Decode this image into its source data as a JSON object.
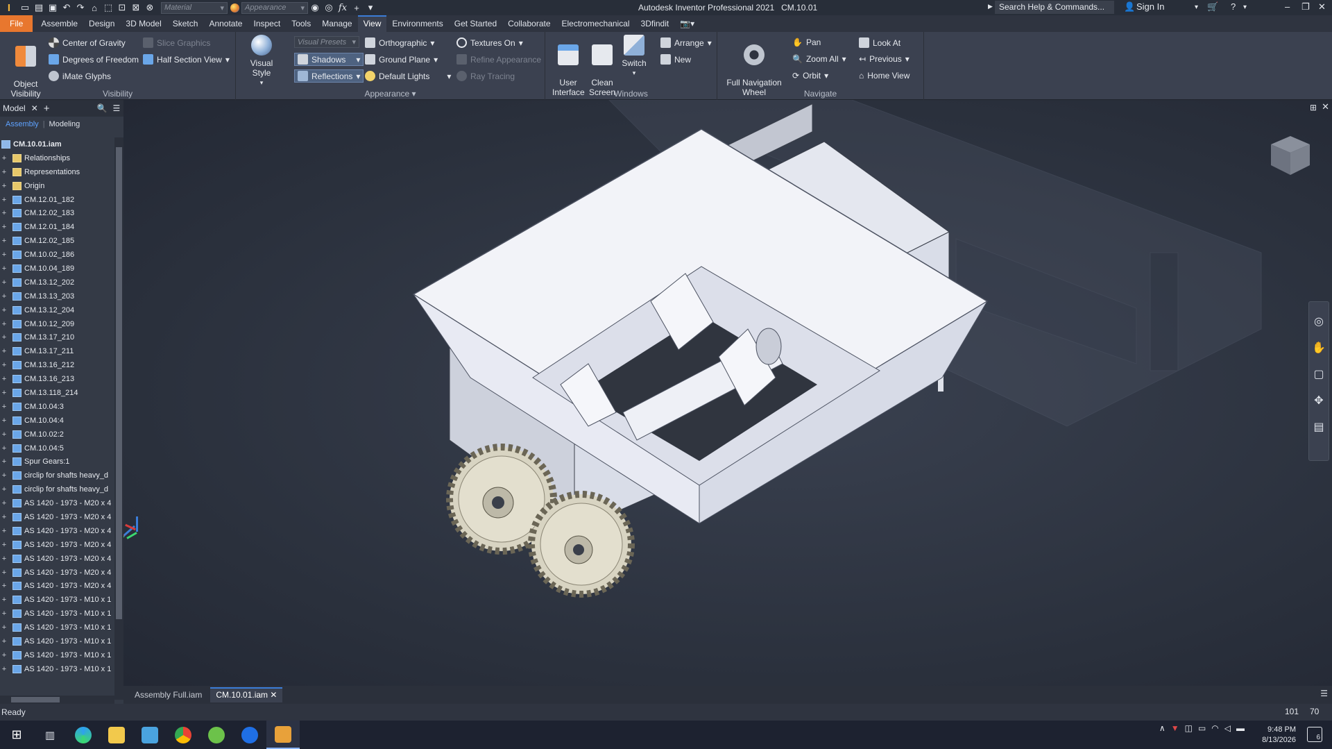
{
  "titlebar": {
    "material_placeholder": "Material",
    "appearance_placeholder": "Appearance",
    "title": "Autodesk Inventor Professional 2021",
    "document": "CM.10.01",
    "search": "Search Help & Commands...",
    "sign_in": "Sign In"
  },
  "tabs": [
    "File",
    "Assemble",
    "Design",
    "3D Model",
    "Sketch",
    "Annotate",
    "Inspect",
    "Tools",
    "Manage",
    "View",
    "Environments",
    "Get Started",
    "Collaborate",
    "Electromechanical",
    "3Dfindit"
  ],
  "active_tab": "View",
  "ribbon": {
    "visibility": {
      "title": "Visibility",
      "object_visibility": "Object\nVisibility",
      "center_of_gravity": "Center of Gravity",
      "degrees_of_freedom": "Degrees of Freedom",
      "imate_glyphs": "iMate Glyphs",
      "slice_graphics": "Slice Graphics",
      "half_section_view": "Half Section View"
    },
    "appearance": {
      "title": "Appearance",
      "visual_style": "Visual Style",
      "visual_presets": "Visual Presets",
      "shadows": "Shadows",
      "reflections": "Reflections",
      "orthographic": "Orthographic",
      "ground_plane": "Ground Plane",
      "default_lights": "Default Lights",
      "textures_on": "Textures On",
      "refine_appearance": "Refine Appearance",
      "ray_tracing": "Ray Tracing"
    },
    "windows": {
      "title": "Windows",
      "user_interface": "User\nInterface",
      "clean_screen": "Clean\nScreen",
      "switch": "Switch",
      "arrange": "Arrange",
      "new": "New"
    },
    "navigate": {
      "title": "Navigate",
      "full_navigation_wheel": "Full Navigation\nWheel",
      "pan": "Pan",
      "zoom_all": "Zoom All",
      "orbit": "Orbit",
      "look_at": "Look At",
      "previous": "Previous",
      "home_view": "Home View"
    }
  },
  "browser": {
    "tab": "Model",
    "sub_assembly": "Assembly",
    "sub_modeling": "Modeling",
    "root": "CM.10.01.iam",
    "items": [
      {
        "label": "Relationships",
        "kind": "folder"
      },
      {
        "label": "Representations",
        "kind": "folder"
      },
      {
        "label": "Origin",
        "kind": "folder"
      },
      {
        "label": "CM.12.01_182",
        "kind": "part"
      },
      {
        "label": "CM.12.02_183",
        "kind": "part"
      },
      {
        "label": "CM.12.01_184",
        "kind": "part"
      },
      {
        "label": "CM.12.02_185",
        "kind": "part"
      },
      {
        "label": "CM.10.02_186",
        "kind": "assembly"
      },
      {
        "label": "CM.10.04_189",
        "kind": "assembly"
      },
      {
        "label": "CM.13.12_202",
        "kind": "part"
      },
      {
        "label": "CM.13.13_203",
        "kind": "part"
      },
      {
        "label": "CM.13.12_204",
        "kind": "part"
      },
      {
        "label": "CM.10.12_209",
        "kind": "assembly"
      },
      {
        "label": "CM.13.17_210",
        "kind": "part"
      },
      {
        "label": "CM.13.17_211",
        "kind": "part"
      },
      {
        "label": "CM.13.16_212",
        "kind": "part"
      },
      {
        "label": "CM.13.16_213",
        "kind": "part"
      },
      {
        "label": "CM.13.118_214",
        "kind": "part"
      },
      {
        "label": "CM.10.04:3",
        "kind": "assembly"
      },
      {
        "label": "CM.10.04:4",
        "kind": "assembly"
      },
      {
        "label": "CM.10.02:2",
        "kind": "assembly"
      },
      {
        "label": "CM.10.04:5",
        "kind": "assembly"
      },
      {
        "label": "Spur Gears:1",
        "kind": "assembly"
      },
      {
        "label": "circlip for shafts heavy_d",
        "kind": "part"
      },
      {
        "label": "circlip for shafts heavy_d",
        "kind": "part"
      },
      {
        "label": "AS 1420 - 1973 - M20 x 4",
        "kind": "part"
      },
      {
        "label": "AS 1420 - 1973 - M20 x 4",
        "kind": "part"
      },
      {
        "label": "AS 1420 - 1973 - M20 x 4",
        "kind": "part"
      },
      {
        "label": "AS 1420 - 1973 - M20 x 4",
        "kind": "part"
      },
      {
        "label": "AS 1420 - 1973 - M20 x 4",
        "kind": "part"
      },
      {
        "label": "AS 1420 - 1973 - M20 x 4",
        "kind": "part"
      },
      {
        "label": "AS 1420 - 1973 - M20 x 4",
        "kind": "part"
      },
      {
        "label": "AS 1420 - 1973 - M10 x 1",
        "kind": "part"
      },
      {
        "label": "AS 1420 - 1973 - M10 x 1",
        "kind": "part"
      },
      {
        "label": "AS 1420 - 1973 - M10 x 1",
        "kind": "part"
      },
      {
        "label": "AS 1420 - 1973 - M10 x 1",
        "kind": "part"
      },
      {
        "label": "AS 1420 - 1973 - M10 x 1",
        "kind": "part"
      },
      {
        "label": "AS 1420 - 1973 - M10 x 1",
        "kind": "part"
      }
    ]
  },
  "doc_tabs": [
    "Assembly Full.iam",
    "CM.10.01.iam"
  ],
  "active_doc": "CM.10.01.iam",
  "status": {
    "text": "Ready",
    "count_a": "101",
    "count_b": "70"
  },
  "clock": {
    "time": "9:48 PM",
    "date": "8/13/2026"
  },
  "notifications": "6",
  "colors": {
    "accent": "#3b7dd8",
    "file_tab": "#e8772e",
    "ribbon": "#3b4150",
    "viewport": "#2a303c"
  }
}
